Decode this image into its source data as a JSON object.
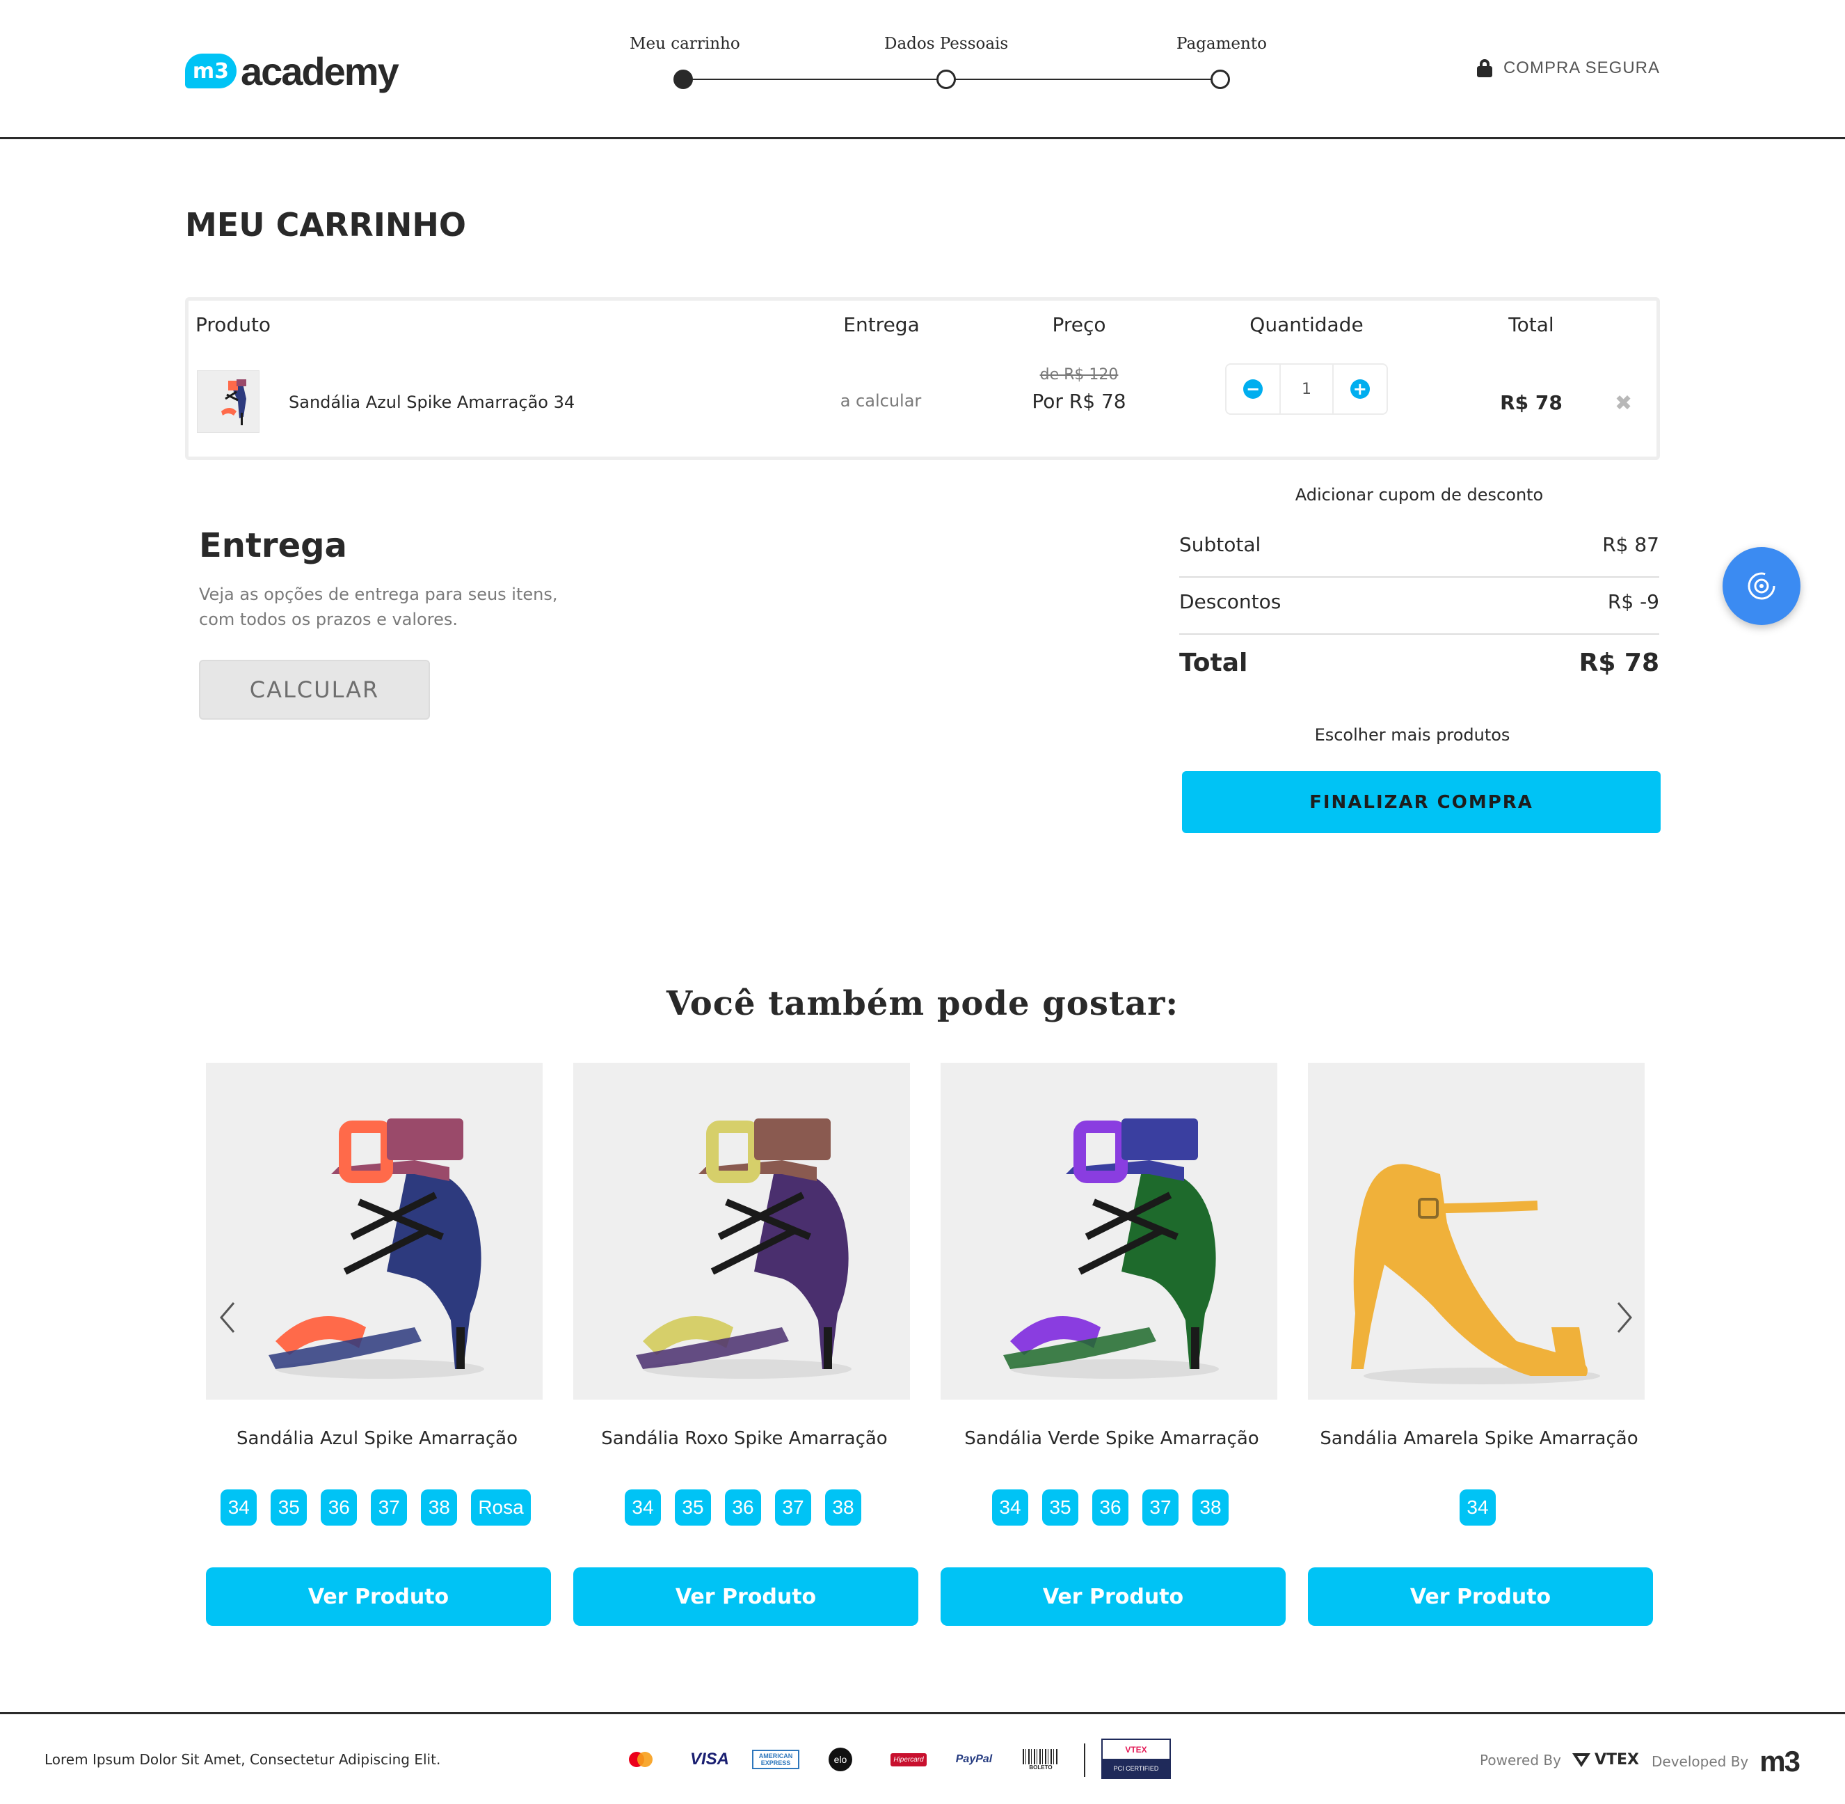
{
  "header": {
    "logo_badge": "m3",
    "logo_text": "academy",
    "steps": [
      "Meu carrinho",
      "Dados Pessoais",
      "Pagamento"
    ],
    "active_step": 0,
    "secure_label": "COMPRA SEGURA"
  },
  "page_title": "MEU CARRINHO",
  "cart": {
    "columns": [
      "Produto",
      "Entrega",
      "Preço",
      "Quantidade",
      "Total"
    ],
    "item": {
      "name": "Sandália Azul Spike Amarração 34",
      "delivery": "a calcular",
      "price_old": "de R$ 120",
      "price_new": "Por R$ 78",
      "quantity": "1",
      "total": "R$ 78",
      "remove": "✖"
    }
  },
  "delivery": {
    "title": "Entrega",
    "description": "Veja as opções de entrega para seus itens, com todos os prazos e valores.",
    "button": "CALCULAR"
  },
  "summary": {
    "coupon_link": "Adicionar cupom de desconto",
    "subtotal_label": "Subtotal",
    "subtotal_value": "R$ 87",
    "discount_label": "Descontos",
    "discount_value": "R$ -9",
    "total_label": "Total",
    "total_value": "R$ 78",
    "more_products": "Escolher mais produtos",
    "finalize": "FINALIZAR COMPRA"
  },
  "recommendations": {
    "title": "Você também pode gostar:",
    "products": [
      {
        "name": "Sandália Azul Spike Amarração",
        "sizes": [
          "34",
          "35",
          "36",
          "37",
          "38",
          "Rosa"
        ],
        "button": "Ver Produto",
        "colors": {
          "strap": "#ff6a4a",
          "band": "#9a4a6a",
          "body": "#2d3a7e",
          "toe": "#ff6a4a"
        }
      },
      {
        "name": "Sandália Roxo Spike Amarração",
        "sizes": [
          "34",
          "35",
          "36",
          "37",
          "38"
        ],
        "button": "Ver Produto",
        "colors": {
          "strap": "#d6cf6a",
          "band": "#8a5a50",
          "body": "#4a2f6e",
          "toe": "#d6cf6a"
        }
      },
      {
        "name": "Sandália Verde Spike Amarração",
        "sizes": [
          "34",
          "35",
          "36",
          "37",
          "38"
        ],
        "button": "Ver Produto",
        "colors": {
          "strap": "#8a3de0",
          "band": "#3a3fa0",
          "body": "#1e6a2c",
          "toe": "#8a3de0"
        }
      },
      {
        "name": "Sandália Amarela Spike Amarração",
        "sizes": [
          "34"
        ],
        "button": "Ver Produto",
        "colors": {
          "strap": "#f0b13a",
          "band": "#f0b13a",
          "body": "#f0b13a",
          "toe": "#f0b13a"
        }
      }
    ]
  },
  "footer": {
    "text": "Lorem Ipsum Dolor Sit Amet, Consectetur Adipiscing Elit.",
    "payments": [
      "mastercard",
      "VISA",
      "AMERICAN EXPRESS",
      "elo",
      "Hipercard",
      "PayPal",
      "BOLETO"
    ],
    "vtex_badge_top": "VTEX",
    "vtex_badge_bottom": "PCI CERTIFIED",
    "powered_by": "Powered By",
    "vtex": "VTEX",
    "developed_by": "Developed By",
    "m3": "m3"
  },
  "colors": {
    "accent": "#00c3f5",
    "text": "#292929",
    "muted": "#7a7a7a",
    "fab": "#3b8bf2"
  }
}
